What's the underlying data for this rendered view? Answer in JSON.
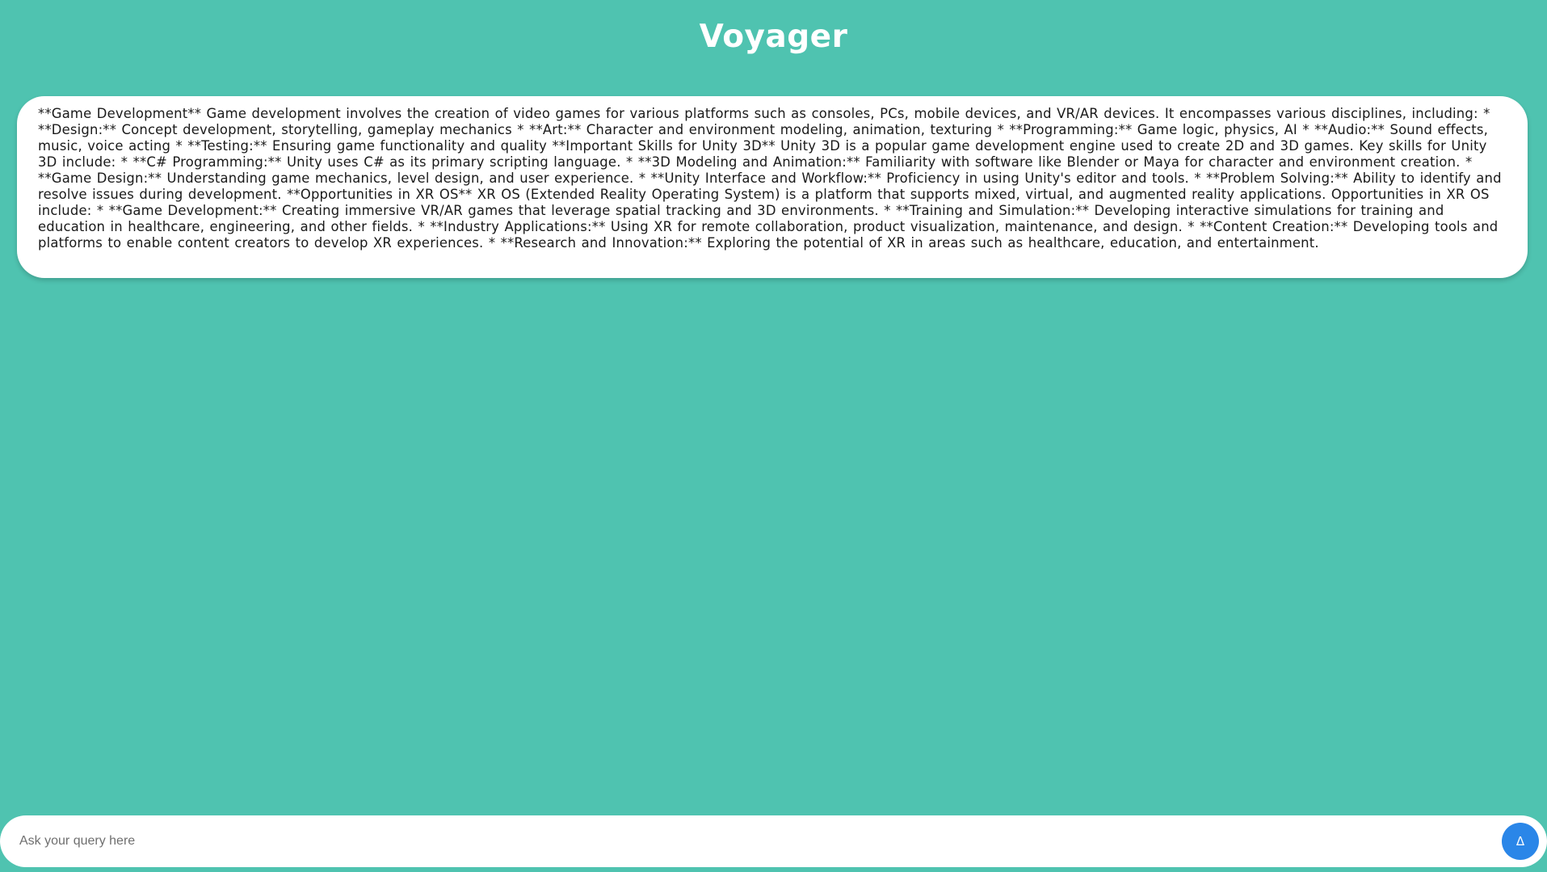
{
  "header": {
    "title": "Voyager"
  },
  "response": {
    "text": "**Game Development** Game development involves the creation of video games for various platforms such as consoles, PCs, mobile devices, and VR/AR devices. It encompasses various disciplines, including: * **Design:** Concept development, storytelling, gameplay mechanics * **Art:** Character and environment modeling, animation, texturing * **Programming:** Game logic, physics, AI * **Audio:** Sound effects, music, voice acting * **Testing:** Ensuring game functionality and quality **Important Skills for Unity 3D** Unity 3D is a popular game development engine used to create 2D and 3D games. Key skills for Unity 3D include: * **C# Programming:** Unity uses C# as its primary scripting language. * **3D Modeling and Animation:** Familiarity with software like Blender or Maya for character and environment creation. * **Game Design:** Understanding game mechanics, level design, and user experience. * **Unity Interface and Workflow:** Proficiency in using Unity's editor and tools. * **Problem Solving:** Ability to identify and resolve issues during development. **Opportunities in XR OS** XR OS (Extended Reality Operating System) is a platform that supports mixed, virtual, and augmented reality applications. Opportunities in XR OS include: * **Game Development:** Creating immersive VR/AR games that leverage spatial tracking and 3D environments. * **Training and Simulation:** Developing interactive simulations for training and education in healthcare, engineering, and other fields. * **Industry Applications:** Using XR for remote collaboration, product visualization, maintenance, and design. * **Content Creation:** Developing tools and platforms to enable content creators to develop XR experiences. * **Research and Innovation:** Exploring the potential of XR in areas such as healthcare, education, and entertainment."
  },
  "query": {
    "placeholder": "Ask your query here",
    "value": "",
    "send_icon": "send-icon",
    "send_glyph": "Δ"
  },
  "colors": {
    "background": "#4fc3b0",
    "card": "#ffffff",
    "send_button": "#2a86e8",
    "title": "#ffffff"
  }
}
